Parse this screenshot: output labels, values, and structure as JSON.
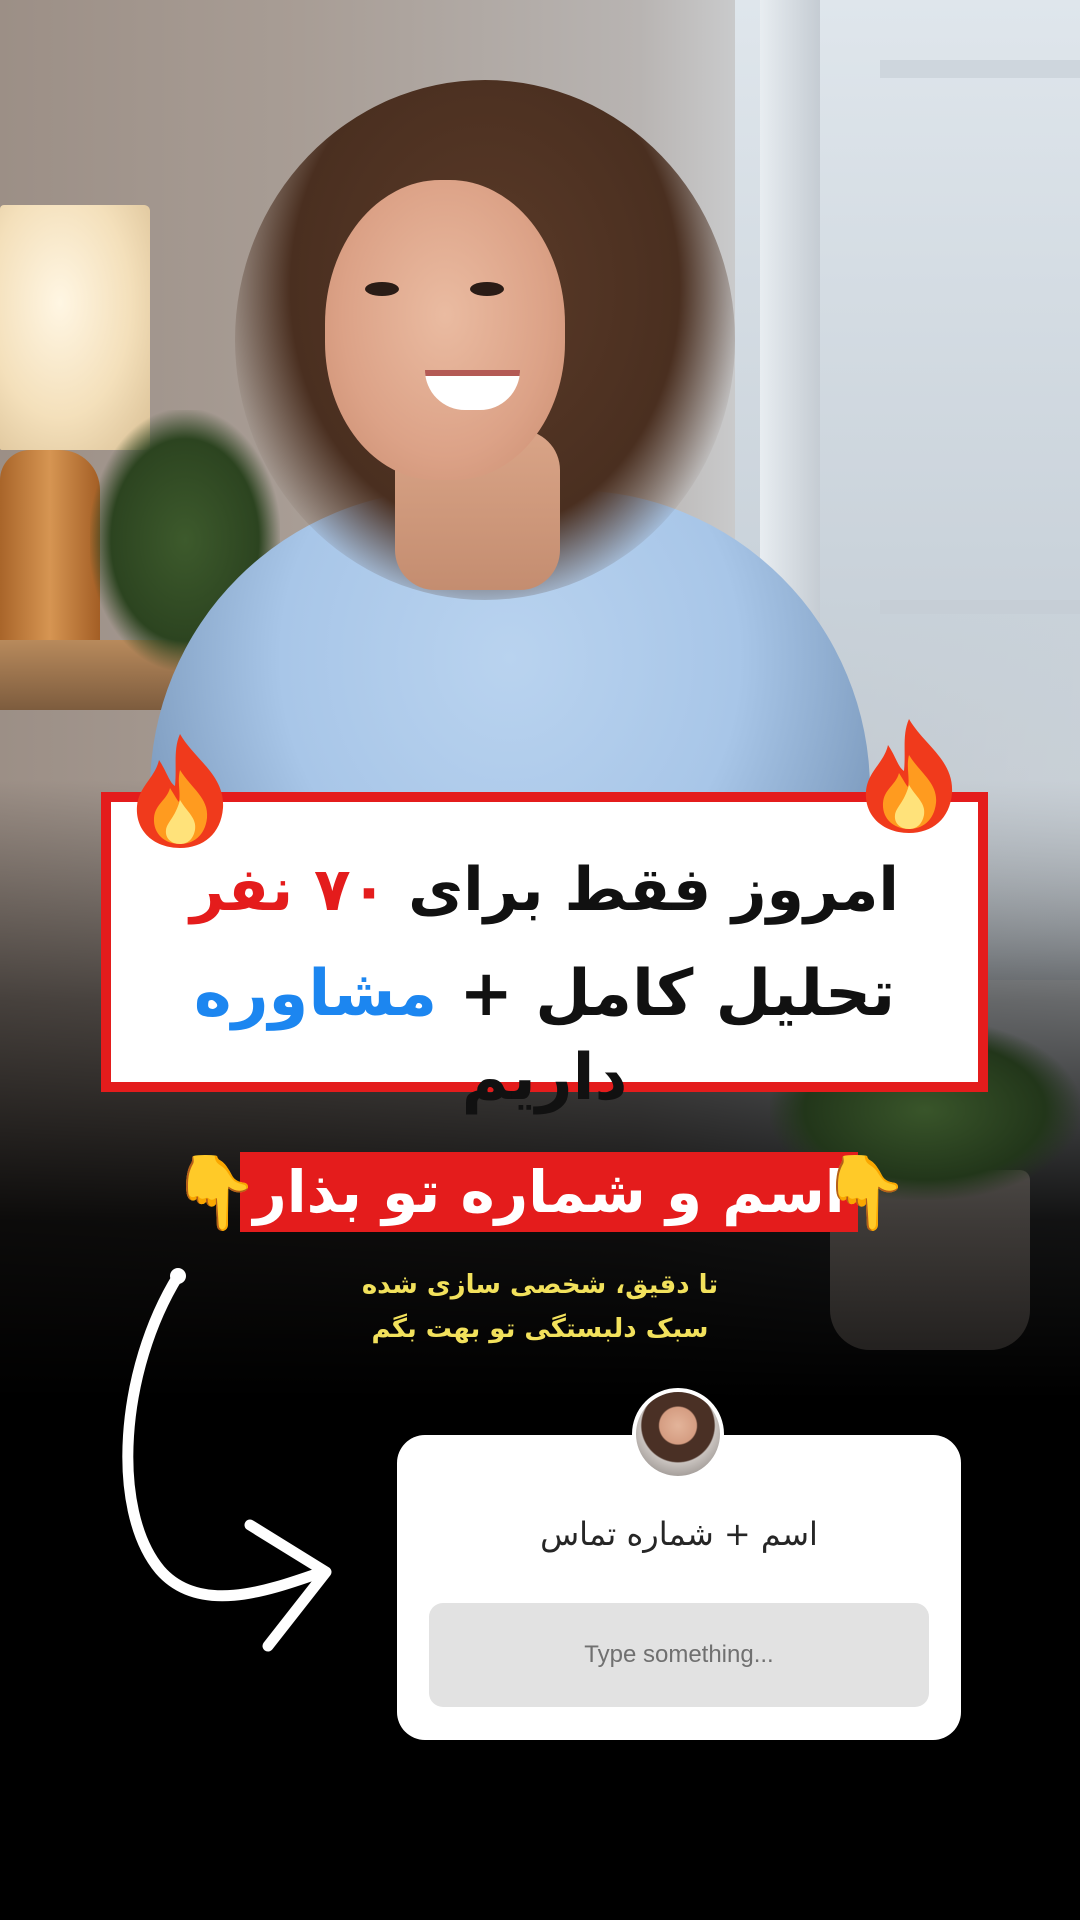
{
  "headline": {
    "line1_prefix": "امروز فقط برای ",
    "line1_highlight": "۷۰ نفر",
    "line2_prefix": "تحلیل کامل + ",
    "line2_highlight": "مشاوره",
    "line2_suffix": " داریم"
  },
  "cta": {
    "banner": "اسم و شماره تو بذار",
    "sub_line1": "تا دقیق، شخصی سازی شده",
    "sub_line2": "سبک دلبستگی تو بهت بگم"
  },
  "question_sticker": {
    "question": "اسم + شماره تماس",
    "input_placeholder": "Type something..."
  },
  "icons": {
    "fire": "fire-icon",
    "pointing": "pointing-hand-icon",
    "arrow": "curved-arrow-icon"
  },
  "colors": {
    "accent_red": "#e41c1c",
    "accent_blue": "#1c86f0",
    "sub_text_yellow": "#f2e15c"
  }
}
